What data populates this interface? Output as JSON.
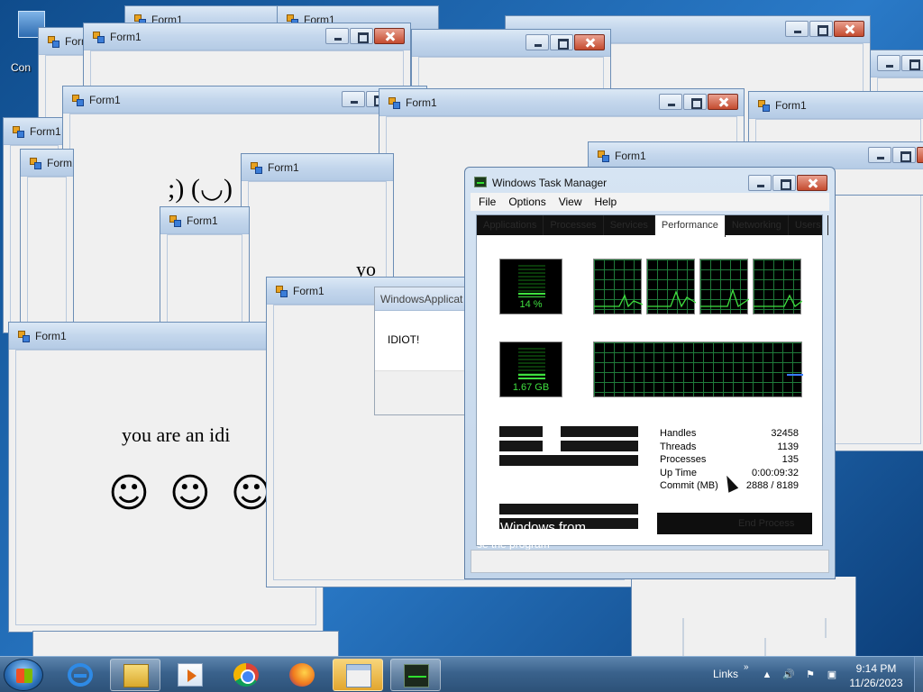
{
  "desktop": {
    "icon_label": "Con"
  },
  "form_title": "Form1",
  "forms": [
    {
      "id": "w1",
      "title": "Form1"
    },
    {
      "id": "w2",
      "title": "Form1"
    },
    {
      "id": "w3",
      "title": "Form1"
    },
    {
      "id": "w4",
      "title": "Form1"
    },
    {
      "id": "w5",
      "title": "Form1"
    },
    {
      "id": "w6",
      "title": "Form1"
    },
    {
      "id": "w7",
      "title": "Form1"
    },
    {
      "id": "w8",
      "title": "Form1"
    },
    {
      "id": "w9",
      "title": "Form1"
    },
    {
      "id": "w10",
      "title": "Form1"
    },
    {
      "id": "w11",
      "title": "Form1"
    },
    {
      "id": "w12",
      "title": "Form1"
    },
    {
      "id": "w13",
      "title": "Form1"
    },
    {
      "id": "w14",
      "title": "Form1"
    },
    {
      "id": "w15",
      "title": "Form1"
    }
  ],
  "messages": {
    "main": "you are an idi",
    "partial": "yo",
    "emoticons": ";)  (◡)",
    "smiley": "☺"
  },
  "msgbox": {
    "title": "WindowsApplicat",
    "text": "IDIOT!"
  },
  "task_manager": {
    "title": "Windows Task Manager",
    "menu": [
      "File",
      "Options",
      "View",
      "Help"
    ],
    "tabs": [
      "Applications",
      "Processes",
      "Services",
      "Performance",
      "Networking",
      "Users"
    ],
    "cpu_usage": "14 %",
    "cpu_fraction": 0.14,
    "memory_usage": "1.67 GB",
    "memory_fraction": 0.2,
    "system_stats": [
      {
        "label": "Handles",
        "value": "32458"
      },
      {
        "label": "Threads",
        "value": "1139"
      },
      {
        "label": "Processes",
        "value": "135"
      },
      {
        "label": "Up Time",
        "value": "0:00:09:32"
      },
      {
        "label": "Commit (MB)",
        "value": "2888 / 8189"
      }
    ],
    "overlay_text_1": "Windows from",
    "overlay_text_2": "se the program",
    "end_button": "End Process"
  },
  "taskbar": {
    "links_label": "Links",
    "links_chevron": "»",
    "tray_up": "▲",
    "tray_icons": [
      "🔊",
      "⚑",
      "▣"
    ],
    "time": "9:14 PM",
    "date": "11/26/2023"
  }
}
